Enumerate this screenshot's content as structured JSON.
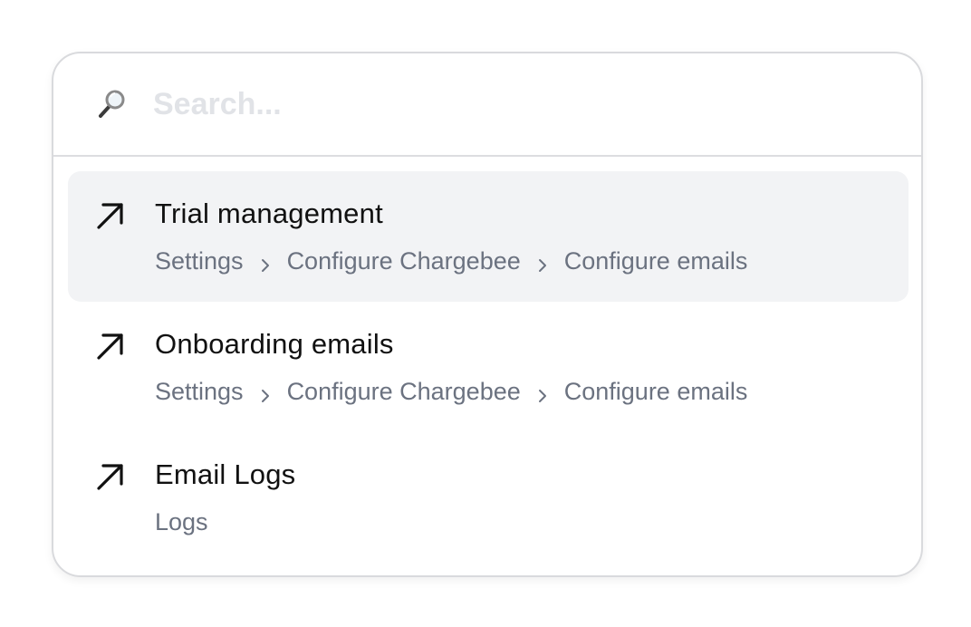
{
  "search": {
    "placeholder": "Search...",
    "value": ""
  },
  "results": [
    {
      "title": "Trial management",
      "path": [
        "Settings",
        "Configure Chargebee",
        "Configure emails"
      ],
      "active": true
    },
    {
      "title": "Onboarding emails",
      "path": [
        "Settings",
        "Configure Chargebee",
        "Configure emails"
      ],
      "active": false
    },
    {
      "title": "Email Logs",
      "path": [
        "Logs"
      ],
      "active": false
    }
  ],
  "icons": {
    "search": "magnifier-icon",
    "result": "arrow-up-right-icon",
    "separator": "chevron-right-icon"
  },
  "colors": {
    "active_row": "#f2f3f5",
    "breadcrumb_text": "#6b7280",
    "placeholder_text": "#e1e3e7"
  }
}
